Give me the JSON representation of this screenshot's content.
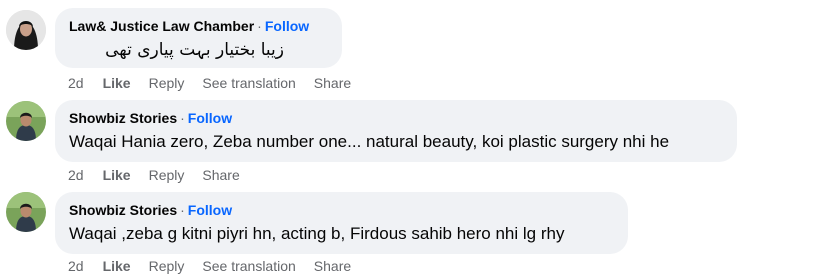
{
  "comments": [
    {
      "author": "Law& Justice Law Chamber",
      "separator": "·",
      "follow": "Follow",
      "text": "زیبا بختیار بہت پیاری تھی",
      "time": "2d",
      "like": "Like",
      "reply": "Reply",
      "translate": "See translation",
      "share": "Share"
    },
    {
      "author": "Showbiz Stories",
      "separator": "·",
      "follow": "Follow",
      "text": "Waqai Hania zero, Zeba number one... natural beauty, koi plastic surgery nhi he",
      "time": "2d",
      "like": "Like",
      "reply": "Reply",
      "share": "Share"
    },
    {
      "author": "Showbiz Stories",
      "separator": "·",
      "follow": "Follow",
      "text": "Waqai ,zeba g kitni piyri hn, acting b, Firdous sahib hero nhi lg rhy",
      "time": "2d",
      "like": "Like",
      "reply": "Reply",
      "translate": "See translation",
      "share": "Share"
    }
  ]
}
